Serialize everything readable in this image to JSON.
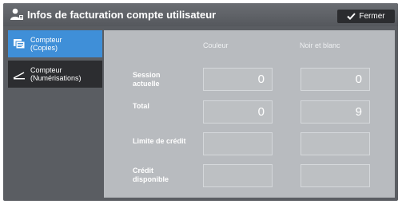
{
  "header": {
    "title": "Infos de facturation compte utilisateur",
    "close_label": "Fermer",
    "title_icon": "user-icon",
    "close_icon": "check-icon"
  },
  "sidebar": {
    "items": [
      {
        "line1": "Compteur",
        "line2": "(Copies)",
        "icon": "copy-counter-icon",
        "active": true
      },
      {
        "line1": "Compteur",
        "line2": "(Numérisations)",
        "icon": "scan-counter-icon",
        "active": false
      }
    ]
  },
  "table": {
    "columns": [
      "Couleur",
      "Noir et blanc"
    ],
    "rows": [
      {
        "label1": "Session",
        "label2": "actuelle",
        "color": "0",
        "bw": "0"
      },
      {
        "label1": "Total",
        "label2": "",
        "color": "0",
        "bw": "9"
      },
      {
        "label1": "Limite de crédit",
        "label2": "",
        "color": "",
        "bw": ""
      },
      {
        "label1": "Crédit",
        "label2": "disponible",
        "color": "",
        "bw": ""
      }
    ]
  },
  "colors": {
    "accent": "#3f8fd8",
    "panel": "#5a5d62",
    "content": "#b8bbbf"
  }
}
